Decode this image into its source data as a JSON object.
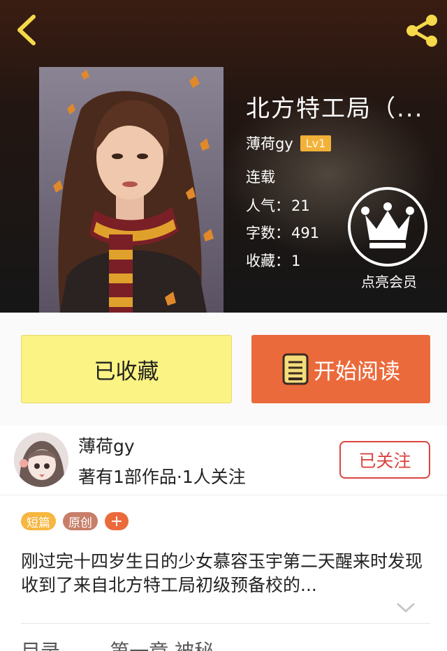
{
  "header": {
    "title": "北方特工局（...",
    "author": "薄荷gy",
    "level": "Lv1",
    "status": "连载",
    "popularity_label": "人气：",
    "popularity": "21",
    "wordcount_label": "字数：",
    "wordcount": "491",
    "favorites_label": "收藏：",
    "favorites": "1",
    "member_label": "点亮会员",
    "icons": {
      "back": "chevron-left-icon",
      "share": "share-icon",
      "crown": "crown-icon"
    }
  },
  "actions": {
    "collected_label": "已收藏",
    "read_label": "开始阅读"
  },
  "author_block": {
    "name": "薄荷gy",
    "stats": "著有1部作品·1人关注",
    "follow_label": "已关注"
  },
  "tags": [
    "短篇",
    "原创",
    "+"
  ],
  "description": "刚过完十四岁生日的少女慕容玉宇第二天醒来时发现收到了来自北方特工局初级预备校的...",
  "partial_row": "目录 ...... 第一章 被秘",
  "colors": {
    "accent_yellow": "#fbf383",
    "accent_orange": "#eb6a3b",
    "follow_red": "#d9443f",
    "level_badge": "#f2b23a"
  }
}
